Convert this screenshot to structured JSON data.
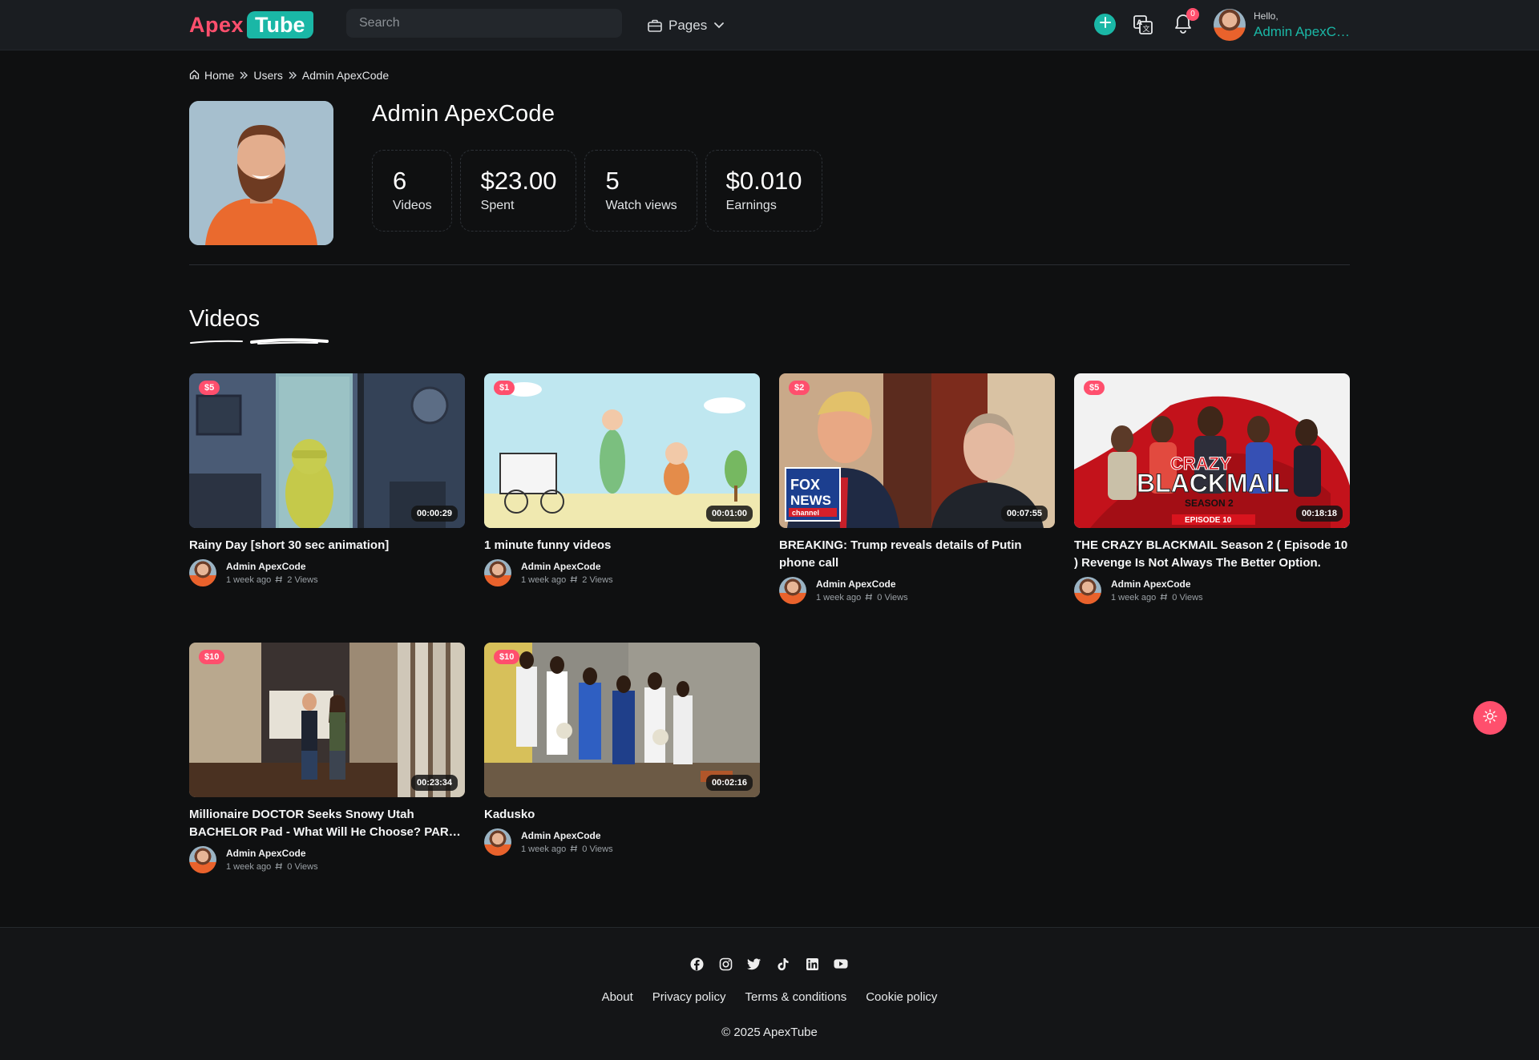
{
  "header": {
    "logo_part1": "Apex",
    "logo_part2": "Tube",
    "search_placeholder": "Search",
    "pages_label": "Pages",
    "notification_count": "0",
    "hello": "Hello,",
    "user_name": "Admin ApexCode",
    "accent_color": "#1ab7a6",
    "brand_color": "#ff4f6d"
  },
  "breadcrumb": {
    "home": "Home",
    "users": "Users",
    "current": "Admin ApexCode"
  },
  "profile": {
    "name": "Admin ApexCode",
    "stats": [
      {
        "value": "6",
        "label": "Videos"
      },
      {
        "value": "$23.00",
        "label": "Spent"
      },
      {
        "value": "5",
        "label": "Watch views"
      },
      {
        "value": "$0.010",
        "label": "Earnings"
      }
    ]
  },
  "videos_section": {
    "title": "Videos",
    "items": [
      {
        "price": "$5",
        "duration": "00:00:29",
        "title": "Rainy Day [short 30 sec animation]",
        "author": "Admin ApexCode",
        "age": "1 week ago",
        "views": "2 Views"
      },
      {
        "price": "$1",
        "duration": "00:01:00",
        "title": "1 minute funny videos",
        "author": "Admin ApexCode",
        "age": "1 week ago",
        "views": "2 Views"
      },
      {
        "price": "$2",
        "duration": "00:07:55",
        "title": "BREAKING: Trump reveals details of Putin phone call",
        "author": "Admin ApexCode",
        "age": "1 week ago",
        "views": "0 Views"
      },
      {
        "price": "$5",
        "duration": "00:18:18",
        "title": "THE CRAZY BLACKMAIL Season 2 ( Episode 10 ) Revenge Is Not Always The Better Option.",
        "author": "Admin ApexCode",
        "age": "1 week ago",
        "views": "0 Views"
      },
      {
        "price": "$10",
        "duration": "00:23:34",
        "title": "Millionaire DOCTOR Seeks Snowy Utah BACHELOR Pad - What Will He Choose? PARK CITY",
        "author": "Admin ApexCode",
        "age": "1 week ago",
        "views": "0 Views"
      },
      {
        "price": "$10",
        "duration": "00:02:16",
        "title": "Kadusko",
        "author": "Admin ApexCode",
        "age": "1 week ago",
        "views": "0 Views"
      }
    ],
    "thumb_texts": {
      "fox_line1": "FOX",
      "fox_line2": "NEWS",
      "fox_line3": "channel",
      "blackmail_line1": "CRAZY",
      "blackmail_line2": "BLACKMAIL",
      "blackmail_line3": "SEASON 2",
      "blackmail_line4": "EPISODE 10"
    }
  },
  "footer": {
    "social_icons": [
      "facebook-icon",
      "instagram-icon",
      "twitter-icon",
      "tiktok-icon",
      "linkedin-icon",
      "youtube-icon"
    ],
    "links": [
      "About",
      "Privacy policy",
      "Terms & conditions",
      "Cookie policy"
    ],
    "copyright": "© 2025 ApexTube"
  }
}
